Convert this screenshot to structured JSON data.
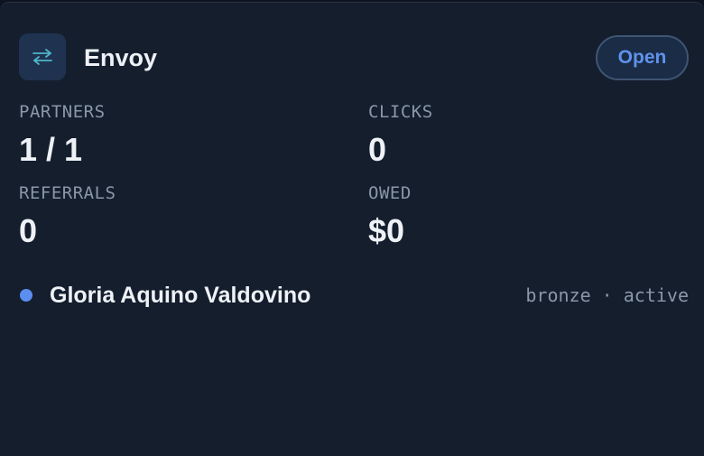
{
  "app": {
    "icon": "swap-arrows-icon",
    "title": "Envoy",
    "open_label": "Open"
  },
  "stats": {
    "partners": {
      "label": "PARTNERS",
      "value": "1 / 1"
    },
    "clicks": {
      "label": "CLICKS",
      "value": "0"
    },
    "referrals": {
      "label": "REFERRALS",
      "value": "0"
    },
    "owed": {
      "label": "OWED",
      "value": "$0"
    }
  },
  "partners": [
    {
      "name": "Gloria Aquino Valdovino",
      "meta": "bronze · active",
      "dot_color": "#5b8ef0"
    }
  ],
  "colors": {
    "accent": "#5f93ec",
    "card_bg": "#141e2d",
    "muted_text": "#8a97a8"
  }
}
